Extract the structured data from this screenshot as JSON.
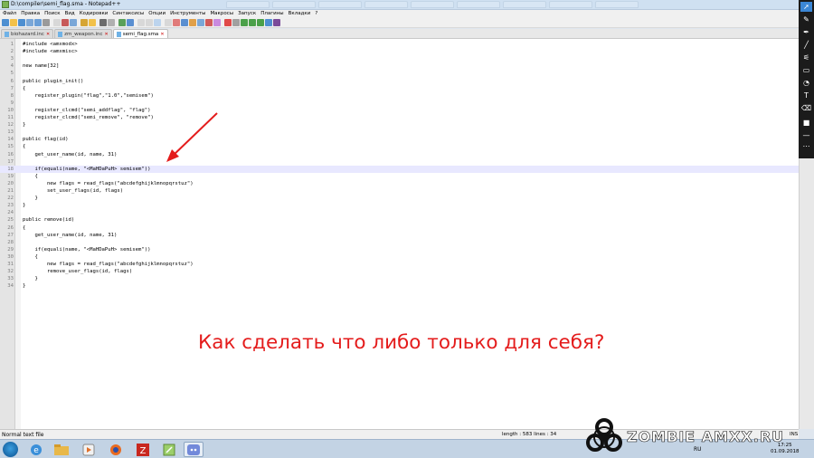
{
  "window": {
    "title": "D:\\compiler\\semi_flag.sma - Notepad++",
    "ghost_tabs": [
      "",
      "",
      "",
      "",
      "",
      "",
      "",
      "",
      ""
    ]
  },
  "menu": [
    "Файл",
    "Правка",
    "Поиск",
    "Вид",
    "Кодировки",
    "Синтаксисы",
    "Опции",
    "Инструменты",
    "Макросы",
    "Запуск",
    "Плагины",
    "Вкладки",
    "?"
  ],
  "tabs": [
    {
      "label": "biohazard.inc",
      "active": false
    },
    {
      "label": "zm_weapon.inc",
      "active": false
    },
    {
      "label": "semi_flag.sma",
      "active": true
    }
  ],
  "code_lines": [
    "#include <amxmodx>",
    "#include <amxmisc>",
    "",
    "new name[32]",
    "",
    "public plugin_init()",
    "{",
    "    register_plugin(\"flag\",\"1.0\",\"semisem\")",
    "",
    "    register_clcmd(\"semi_addflag\", \"flag\")",
    "    register_clcmd(\"semi_remove\", \"remove\")",
    "}",
    "",
    "public flag(id)",
    "{",
    "    get_user_name(id, name, 31)",
    "",
    "    if(equali(name, \"<MaHDaPuH> semisem\"))",
    "    {",
    "        new flags = read_flags(\"abcdefghijklmnopqrstuz\")",
    "        set_user_flags(id, flags)",
    "    }",
    "}",
    "",
    "public remove(id)",
    "{",
    "    get_user_name(id, name, 31)",
    "",
    "    if(equali(name, \"<MaHDaPuH> semisem\"))",
    "    {",
    "        new flags = read_flags(\"abcdefghijklmnopqrstuz\")",
    "        remove_user_flags(id, flags)",
    "    }",
    "}"
  ],
  "highlighted_line": 18,
  "caption": "Как сделать что либо только для себя?",
  "status": {
    "file_type": "Normal text file",
    "length_lines": "length : 583    lines : 34",
    "mode": "INS"
  },
  "watermark": "ZOMBIE AMXX.RU",
  "tray": {
    "lang": "RU",
    "time": "17:25",
    "date": "01.09.2018"
  },
  "colors": {
    "caption": "#e41c1c",
    "arrow": "#e41c1c",
    "highlight": "#e8e8ff"
  }
}
